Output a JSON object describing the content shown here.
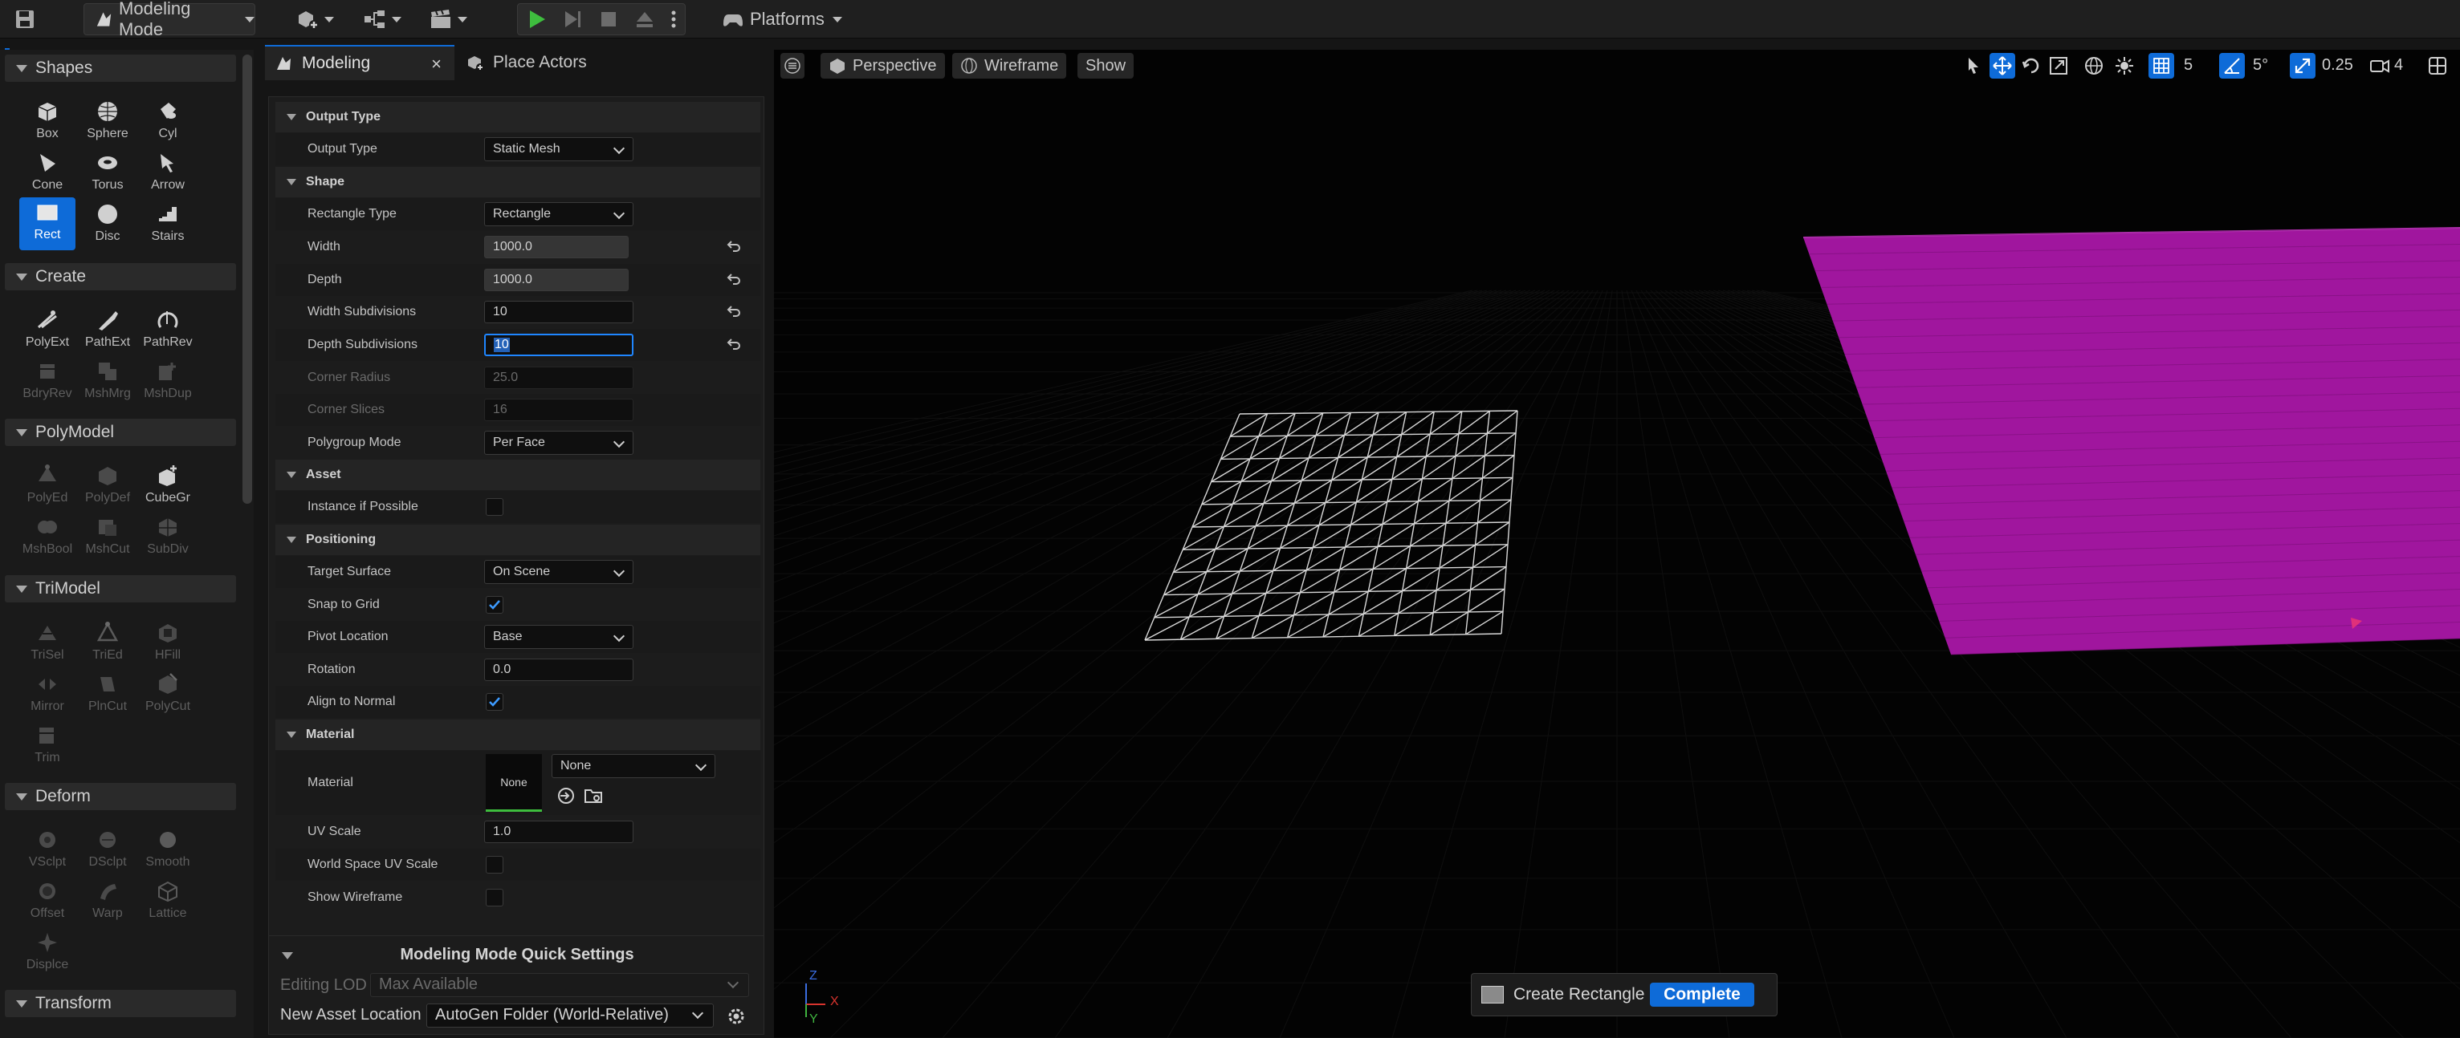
{
  "topbar": {
    "mode_label": "Modeling Mode",
    "platforms_label": "Platforms"
  },
  "palette": {
    "sections": [
      {
        "label": "Shapes",
        "tools": [
          "Box",
          "Sphere",
          "Cyl",
          "Cone",
          "Torus",
          "Arrow",
          "Rect",
          "Disc",
          "Stairs"
        ],
        "active": "Rect"
      },
      {
        "label": "Create",
        "tools": [
          "PolyExt",
          "PathExt",
          "PathRev",
          "BdryRev",
          "MshMrg",
          "MshDup"
        ]
      },
      {
        "label": "PolyModel",
        "tools": [
          "PolyEd",
          "PolyDef",
          "CubeGr",
          "MshBool",
          "MshCut",
          "SubDiv"
        ]
      },
      {
        "label": "TriModel",
        "tools": [
          "TriSel",
          "TriEd",
          "HFill",
          "Mirror",
          "PlnCut",
          "PolyCut",
          "Trim"
        ]
      },
      {
        "label": "Deform",
        "tools": [
          "VSclpt",
          "DSclpt",
          "Smooth",
          "Offset",
          "Warp",
          "Lattice",
          "Displce"
        ]
      },
      {
        "label": "Transform",
        "tools": []
      }
    ]
  },
  "details": {
    "tabs": [
      "Modeling",
      "Place Actors"
    ],
    "sections": {
      "output_type": "Output Type",
      "shape": "Shape",
      "asset": "Asset",
      "positioning": "Positioning",
      "material": "Material"
    },
    "rows": {
      "output_type": {
        "label": "Output Type",
        "value": "Static Mesh"
      },
      "rectangle_type": {
        "label": "Rectangle Type",
        "value": "Rectangle"
      },
      "width": {
        "label": "Width",
        "value": "1000.0"
      },
      "depth": {
        "label": "Depth",
        "value": "1000.0"
      },
      "width_subdivisions": {
        "label": "Width Subdivisions",
        "value": "10"
      },
      "depth_subdivisions": {
        "label": "Depth Subdivisions",
        "value": "10"
      },
      "corner_radius": {
        "label": "Corner Radius",
        "value": "25.0"
      },
      "corner_slices": {
        "label": "Corner Slices",
        "value": "16"
      },
      "polygroup_mode": {
        "label": "Polygroup Mode",
        "value": "Per Face"
      },
      "instance_if_possible": {
        "label": "Instance if Possible",
        "checked": false
      },
      "target_surface": {
        "label": "Target Surface",
        "value": "On Scene"
      },
      "snap_to_grid": {
        "label": "Snap to Grid",
        "checked": true
      },
      "pivot_location": {
        "label": "Pivot Location",
        "value": "Base"
      },
      "rotation": {
        "label": "Rotation",
        "value": "0.0"
      },
      "align_to_normal": {
        "label": "Align to Normal",
        "checked": true
      },
      "material": {
        "label": "Material",
        "thumb": "None",
        "value": "None"
      },
      "uv_scale": {
        "label": "UV Scale",
        "value": "1.0"
      },
      "world_space_uv_scale": {
        "label": "World Space UV Scale",
        "checked": false
      },
      "show_wireframe": {
        "label": "Show Wireframe",
        "checked": false
      }
    },
    "quick_settings": {
      "title": "Modeling Mode Quick Settings",
      "editing_lod_label": "Editing LOD",
      "editing_lod_value": "Max Available",
      "new_asset_location_label": "New Asset Location",
      "new_asset_location_value": "AutoGen Folder (World-Relative)"
    }
  },
  "viewport": {
    "perspective_label": "Perspective",
    "wireframe_label": "Wireframe",
    "show_label": "Show",
    "grid_snap": "5",
    "angle_snap": "5°",
    "scale_snap": "0.25",
    "camera_speed": "4",
    "gizmo_x": "X",
    "gizmo_y": "Y",
    "gizmo_z": "Z",
    "create_label": "Create Rectangle",
    "complete_label": "Complete"
  },
  "colors": {
    "accent": "#0e6bd8",
    "plane": "#a0169e",
    "background": "#030303"
  }
}
